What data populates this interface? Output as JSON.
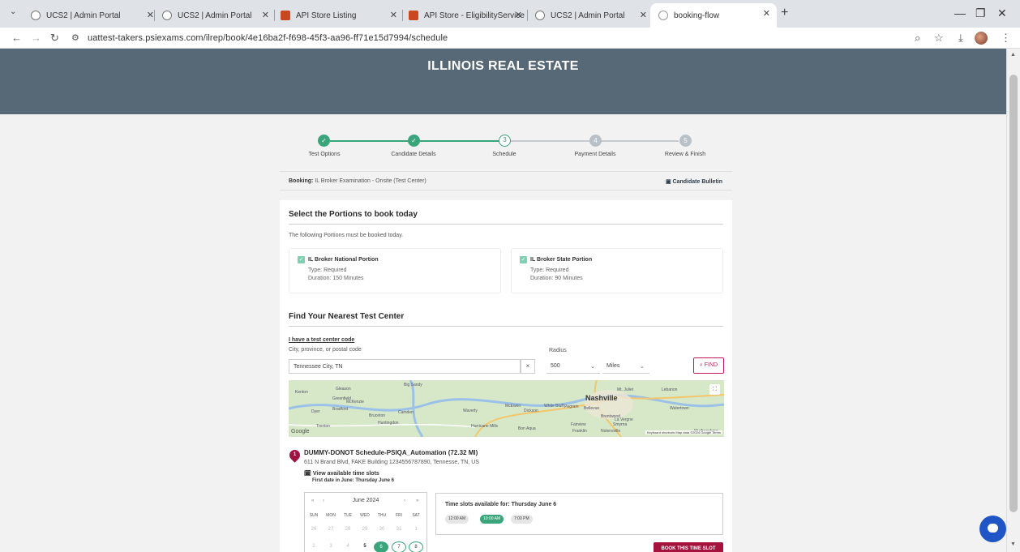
{
  "browser": {
    "tabs": [
      {
        "title": "UCS2 | Admin Portal",
        "icon": "ucs-icon"
      },
      {
        "title": "UCS2 | Admin Portal",
        "icon": "ucs-icon"
      },
      {
        "title": "API Store Listing",
        "icon": "api-store-icon"
      },
      {
        "title": "API Store - EligibilityService",
        "icon": "api-store-icon"
      },
      {
        "title": "UCS2 | Admin Portal",
        "icon": "ucs-icon"
      },
      {
        "title": "booking-flow",
        "icon": "booking-icon",
        "active": true
      }
    ],
    "url": "uattest-takers.psiexams.com/ilrep/book/4e16ba2f-f698-45f3-aa96-ff71e15d7994/schedule"
  },
  "header": {
    "title": "ILLINOIS REAL ESTATE"
  },
  "stepper": {
    "steps": [
      {
        "label": "Test Options",
        "state": "done",
        "num": "✓"
      },
      {
        "label": "Candidate Details",
        "state": "done",
        "num": "✓"
      },
      {
        "label": "Schedule",
        "state": "current",
        "num": "3"
      },
      {
        "label": "Payment Details",
        "state": "todo",
        "num": "4"
      },
      {
        "label": "Review & Finish",
        "state": "todo",
        "num": "5"
      }
    ]
  },
  "booking": {
    "label": "Booking:",
    "value": "IL Broker Examination - Onsite (Test Center)",
    "bulletin": "Candidate Bulletin"
  },
  "portions": {
    "title": "Select the Portions to book today",
    "intro": "The following Portions must be booked today.",
    "items": [
      {
        "name": "IL Broker National Portion",
        "type": "Type: Required",
        "duration": "Duration: 150 Minutes"
      },
      {
        "name": "IL Broker State Portion",
        "type": "Type: Required",
        "duration": "Duration: 90 Minutes"
      }
    ]
  },
  "finder": {
    "title": "Find Your Nearest Test Center",
    "code_link": "I have a test center code",
    "city_label": "City, province, or postal code",
    "city_value": "Tennessee City, TN",
    "radius_label": "Radius",
    "radius_value": "500",
    "unit_value": "Miles",
    "find_label": "FIND"
  },
  "map": {
    "places": [
      "Kenton",
      "Gleason",
      "Big Sandy",
      "Greenfield",
      "McKenzie",
      "Bradford",
      "Dyer",
      "Camden",
      "Trenton",
      "Huntingdon",
      "Bruceton",
      "Waverly",
      "McEwen",
      "Dickson",
      "White Bluff",
      "Pegram",
      "Bellevue",
      "Brentwood",
      "Fairview",
      "Mt. Juliet",
      "Lebanon",
      "Watertown",
      "Murfreesboro",
      "Bon Aqua",
      "Hurricane Mills",
      "Nolensville",
      "Franklin",
      "Smyrna",
      "La Vergne"
    ],
    "city": "Nashville",
    "google": "Google",
    "attribution": "Keyboard shortcuts  Map data ©2024 Google  Terms"
  },
  "location": {
    "pin": "1",
    "name": "DUMMY-DONOT Schedule-PSIQA_Automation (72.32 MI)",
    "address": "611 N Brand Blvd, FAKE Building 1234556787890, Tennesse, TN, US",
    "slots_link": "View available time slots",
    "first_date": "First date in June: Thursday June 6"
  },
  "calendar": {
    "month": "June 2024",
    "dow": [
      "SUN",
      "MON",
      "TUE",
      "WED",
      "THU",
      "FRI",
      "SAT"
    ],
    "week1": [
      "26",
      "27",
      "28",
      "29",
      "30",
      "31",
      "1"
    ],
    "week2": [
      "2",
      "3",
      "4",
      "5",
      "6",
      "7",
      "8"
    ]
  },
  "slots": {
    "title": "Time slots available for: Thursday June 6",
    "times": [
      "12:00 AM",
      "10:00 AM",
      "7:00 PM"
    ],
    "selected": "10:00 AM"
  },
  "book_button": "BOOK THIS TIME SLOT"
}
